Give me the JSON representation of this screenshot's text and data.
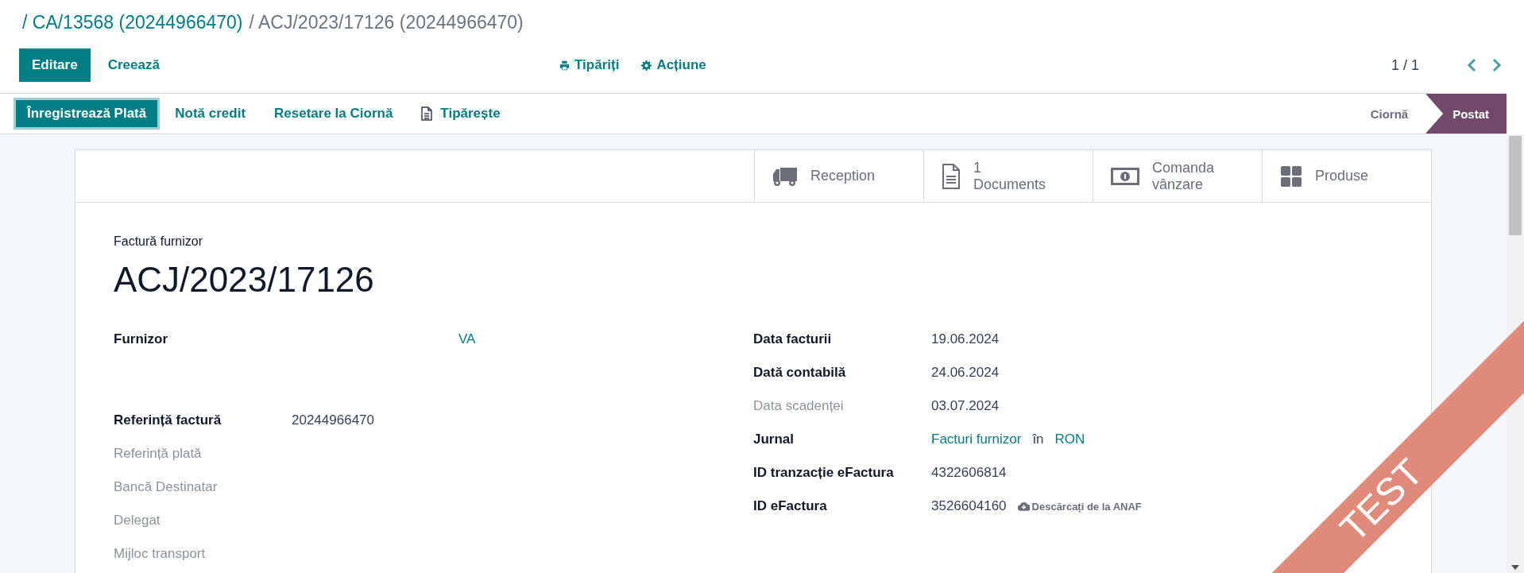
{
  "breadcrumb": [
    {
      "text": "/ CA/13568 (20244966470)",
      "kind": "link"
    },
    {
      "text": "/ ACJ/2023/17126 (20244966470)",
      "kind": "current"
    }
  ],
  "control_panel": {
    "buttons": [
      {
        "label": "Editare",
        "kind": "primary"
      },
      {
        "label": "Creează",
        "kind": "secondary"
      }
    ],
    "menus": [
      {
        "label": "Tipăriți",
        "kind": "print"
      },
      {
        "label": "Acțiune",
        "kind": "gear"
      }
    ],
    "pager": "1 / 1"
  },
  "action_buttons": [
    {
      "label": "Înregistrează Plată",
      "kind": "primary"
    },
    {
      "label": "Notă credit",
      "kind": "secondary"
    },
    {
      "label": "Resetare la Ciornă",
      "kind": "secondary"
    },
    {
      "label": "Tipărește",
      "kind": "file"
    }
  ],
  "status_stages": [
    {
      "label": "Ciornă",
      "selected": false
    },
    {
      "label": "Postat",
      "selected": true
    }
  ],
  "smart_buttons": [
    {
      "label": "Reception",
      "kind": "truck"
    },
    {
      "label": "1\nDocuments",
      "kind": "file"
    },
    {
      "label": "Comanda\nvânzare",
      "kind": "money"
    },
    {
      "label": "Produse",
      "kind": "grid"
    }
  ],
  "sheet": {
    "subtitle": "Factură furnizor",
    "title": "ACJ/2023/17126",
    "left_fields": [
      {
        "label": "Furnizor",
        "muted": false,
        "kind": "partner",
        "value": [
          {
            "text": "VA",
            "kind": "link"
          }
        ]
      },
      {
        "label": "Referință factură",
        "muted": false,
        "value": [
          {
            "text": "20244966470",
            "kind": "text"
          }
        ]
      },
      {
        "label": "Referință plată",
        "muted": true
      },
      {
        "label": "Bancă Destinatar",
        "muted": true
      },
      {
        "label": "Delegat",
        "muted": true
      },
      {
        "label": "Mijloc transport",
        "muted": true
      }
    ],
    "right_fields": [
      {
        "label": "Data facturii",
        "muted": false,
        "value": [
          {
            "text": "19.06.2024",
            "kind": "text"
          }
        ]
      },
      {
        "label": "Dată contabilă",
        "muted": false,
        "value": [
          {
            "text": "24.06.2024",
            "kind": "text"
          }
        ]
      },
      {
        "label": "Data scadenței",
        "muted": true,
        "value": [
          {
            "text": "03.07.2024",
            "kind": "text"
          }
        ]
      },
      {
        "label": "Jurnal",
        "muted": false,
        "value": [
          {
            "text": "Facturi furnizor",
            "kind": "link"
          },
          {
            "text": "în",
            "kind": "text"
          },
          {
            "text": "RON",
            "kind": "link"
          }
        ]
      },
      {
        "label": "ID tranzacție eFactura",
        "muted": false,
        "value": [
          {
            "text": "4322606814",
            "kind": "text"
          }
        ]
      },
      {
        "label": "ID eFactura",
        "muted": false,
        "value": [
          {
            "text": "3526604160",
            "kind": "text"
          },
          {
            "text": "Descărcați de la ANAF",
            "kind": "download"
          }
        ]
      }
    ]
  },
  "ribbon": "TEST"
}
